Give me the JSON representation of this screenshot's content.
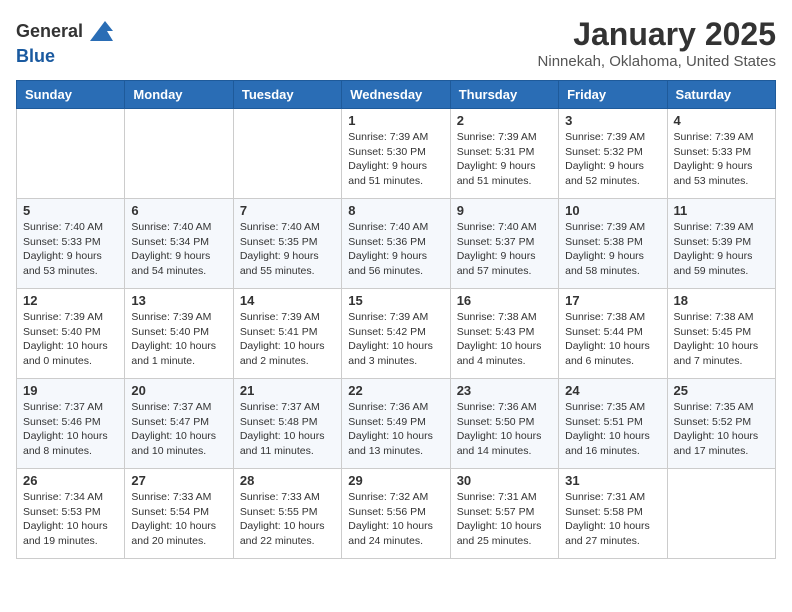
{
  "header": {
    "logo_general": "General",
    "logo_blue": "Blue",
    "month_title": "January 2025",
    "location": "Ninnekah, Oklahoma, United States"
  },
  "days_of_week": [
    "Sunday",
    "Monday",
    "Tuesday",
    "Wednesday",
    "Thursday",
    "Friday",
    "Saturday"
  ],
  "weeks": [
    [
      {
        "day": "",
        "info": ""
      },
      {
        "day": "",
        "info": ""
      },
      {
        "day": "",
        "info": ""
      },
      {
        "day": "1",
        "info": "Sunrise: 7:39 AM\nSunset: 5:30 PM\nDaylight: 9 hours\nand 51 minutes."
      },
      {
        "day": "2",
        "info": "Sunrise: 7:39 AM\nSunset: 5:31 PM\nDaylight: 9 hours\nand 51 minutes."
      },
      {
        "day": "3",
        "info": "Sunrise: 7:39 AM\nSunset: 5:32 PM\nDaylight: 9 hours\nand 52 minutes."
      },
      {
        "day": "4",
        "info": "Sunrise: 7:39 AM\nSunset: 5:33 PM\nDaylight: 9 hours\nand 53 minutes."
      }
    ],
    [
      {
        "day": "5",
        "info": "Sunrise: 7:40 AM\nSunset: 5:33 PM\nDaylight: 9 hours\nand 53 minutes."
      },
      {
        "day": "6",
        "info": "Sunrise: 7:40 AM\nSunset: 5:34 PM\nDaylight: 9 hours\nand 54 minutes."
      },
      {
        "day": "7",
        "info": "Sunrise: 7:40 AM\nSunset: 5:35 PM\nDaylight: 9 hours\nand 55 minutes."
      },
      {
        "day": "8",
        "info": "Sunrise: 7:40 AM\nSunset: 5:36 PM\nDaylight: 9 hours\nand 56 minutes."
      },
      {
        "day": "9",
        "info": "Sunrise: 7:40 AM\nSunset: 5:37 PM\nDaylight: 9 hours\nand 57 minutes."
      },
      {
        "day": "10",
        "info": "Sunrise: 7:39 AM\nSunset: 5:38 PM\nDaylight: 9 hours\nand 58 minutes."
      },
      {
        "day": "11",
        "info": "Sunrise: 7:39 AM\nSunset: 5:39 PM\nDaylight: 9 hours\nand 59 minutes."
      }
    ],
    [
      {
        "day": "12",
        "info": "Sunrise: 7:39 AM\nSunset: 5:40 PM\nDaylight: 10 hours\nand 0 minutes."
      },
      {
        "day": "13",
        "info": "Sunrise: 7:39 AM\nSunset: 5:40 PM\nDaylight: 10 hours\nand 1 minute."
      },
      {
        "day": "14",
        "info": "Sunrise: 7:39 AM\nSunset: 5:41 PM\nDaylight: 10 hours\nand 2 minutes."
      },
      {
        "day": "15",
        "info": "Sunrise: 7:39 AM\nSunset: 5:42 PM\nDaylight: 10 hours\nand 3 minutes."
      },
      {
        "day": "16",
        "info": "Sunrise: 7:38 AM\nSunset: 5:43 PM\nDaylight: 10 hours\nand 4 minutes."
      },
      {
        "day": "17",
        "info": "Sunrise: 7:38 AM\nSunset: 5:44 PM\nDaylight: 10 hours\nand 6 minutes."
      },
      {
        "day": "18",
        "info": "Sunrise: 7:38 AM\nSunset: 5:45 PM\nDaylight: 10 hours\nand 7 minutes."
      }
    ],
    [
      {
        "day": "19",
        "info": "Sunrise: 7:37 AM\nSunset: 5:46 PM\nDaylight: 10 hours\nand 8 minutes."
      },
      {
        "day": "20",
        "info": "Sunrise: 7:37 AM\nSunset: 5:47 PM\nDaylight: 10 hours\nand 10 minutes."
      },
      {
        "day": "21",
        "info": "Sunrise: 7:37 AM\nSunset: 5:48 PM\nDaylight: 10 hours\nand 11 minutes."
      },
      {
        "day": "22",
        "info": "Sunrise: 7:36 AM\nSunset: 5:49 PM\nDaylight: 10 hours\nand 13 minutes."
      },
      {
        "day": "23",
        "info": "Sunrise: 7:36 AM\nSunset: 5:50 PM\nDaylight: 10 hours\nand 14 minutes."
      },
      {
        "day": "24",
        "info": "Sunrise: 7:35 AM\nSunset: 5:51 PM\nDaylight: 10 hours\nand 16 minutes."
      },
      {
        "day": "25",
        "info": "Sunrise: 7:35 AM\nSunset: 5:52 PM\nDaylight: 10 hours\nand 17 minutes."
      }
    ],
    [
      {
        "day": "26",
        "info": "Sunrise: 7:34 AM\nSunset: 5:53 PM\nDaylight: 10 hours\nand 19 minutes."
      },
      {
        "day": "27",
        "info": "Sunrise: 7:33 AM\nSunset: 5:54 PM\nDaylight: 10 hours\nand 20 minutes."
      },
      {
        "day": "28",
        "info": "Sunrise: 7:33 AM\nSunset: 5:55 PM\nDaylight: 10 hours\nand 22 minutes."
      },
      {
        "day": "29",
        "info": "Sunrise: 7:32 AM\nSunset: 5:56 PM\nDaylight: 10 hours\nand 24 minutes."
      },
      {
        "day": "30",
        "info": "Sunrise: 7:31 AM\nSunset: 5:57 PM\nDaylight: 10 hours\nand 25 minutes."
      },
      {
        "day": "31",
        "info": "Sunrise: 7:31 AM\nSunset: 5:58 PM\nDaylight: 10 hours\nand 27 minutes."
      },
      {
        "day": "",
        "info": ""
      }
    ]
  ]
}
